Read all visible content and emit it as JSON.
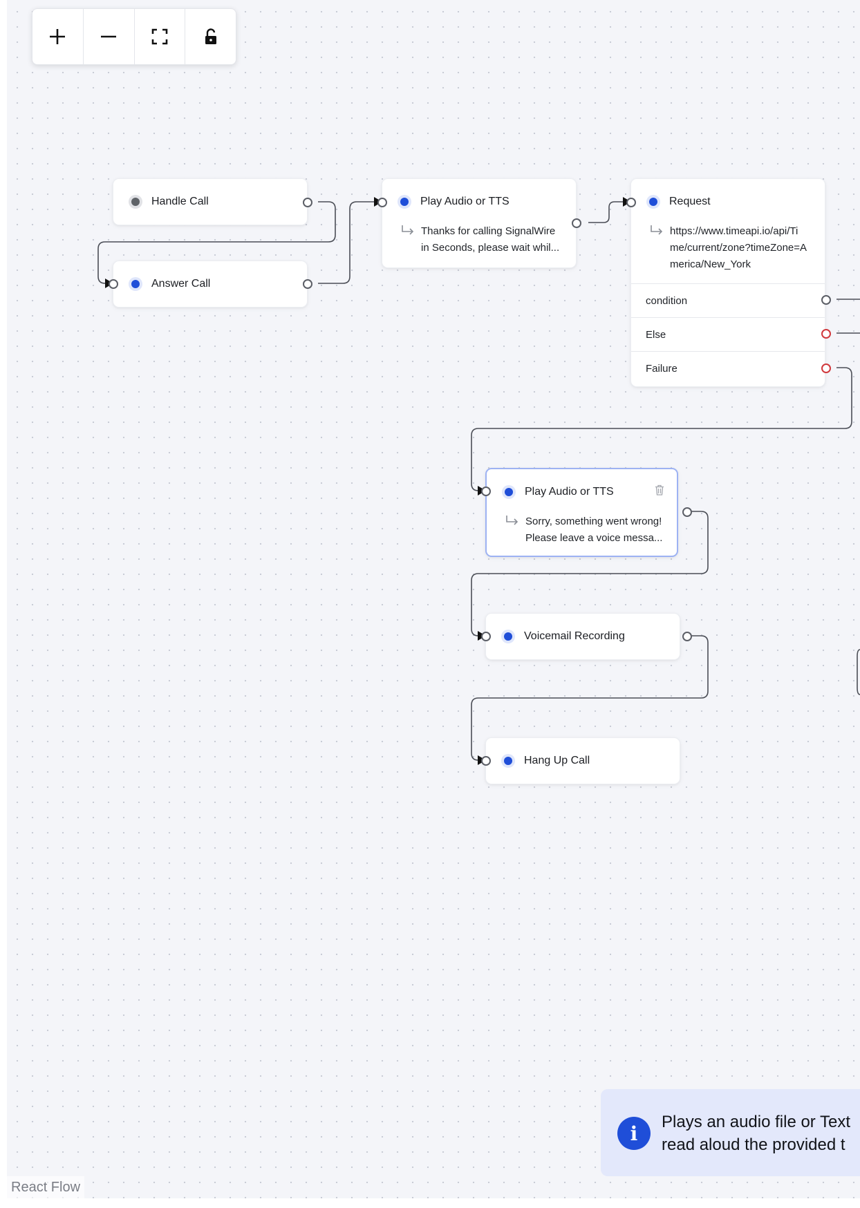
{
  "controls": {
    "zoom_in": "plus-icon",
    "zoom_out": "minus-icon",
    "fit_view": "fit-view-icon",
    "lock": "unlock-icon"
  },
  "nodes": {
    "handle_call": {
      "title": "Handle Call"
    },
    "answer_call": {
      "title": "Answer Call"
    },
    "play_tts_1": {
      "title": "Play Audio or TTS",
      "detail_line1": "Thanks for calling SignalWire",
      "detail_line2": "in Seconds, please wait whil..."
    },
    "request": {
      "title": "Request",
      "url_line1": "https://www.timeapi.io/api/Ti",
      "url_line2": "me/current/zone?timeZone=A",
      "url_line3": "merica/New_York",
      "outputs": [
        "condition",
        "Else",
        "Failure"
      ]
    },
    "play_tts_2": {
      "title": "Play Audio or TTS",
      "detail_line1": "Sorry, something went wrong!",
      "detail_line2": "Please leave a voice messa..."
    },
    "voicemail": {
      "title": "Voicemail Recording"
    },
    "hangup": {
      "title": "Hang Up Call"
    }
  },
  "info_banner": {
    "line1": "Plays an audio file or Text",
    "line2": "read aloud the provided t"
  },
  "attribution": "React Flow",
  "colors": {
    "accent": "#1f4ed8",
    "canvas": "#f4f5f9",
    "edge": "#4a4d55",
    "error_handle": "#d0383c",
    "selected_border": "#9db2f3"
  }
}
